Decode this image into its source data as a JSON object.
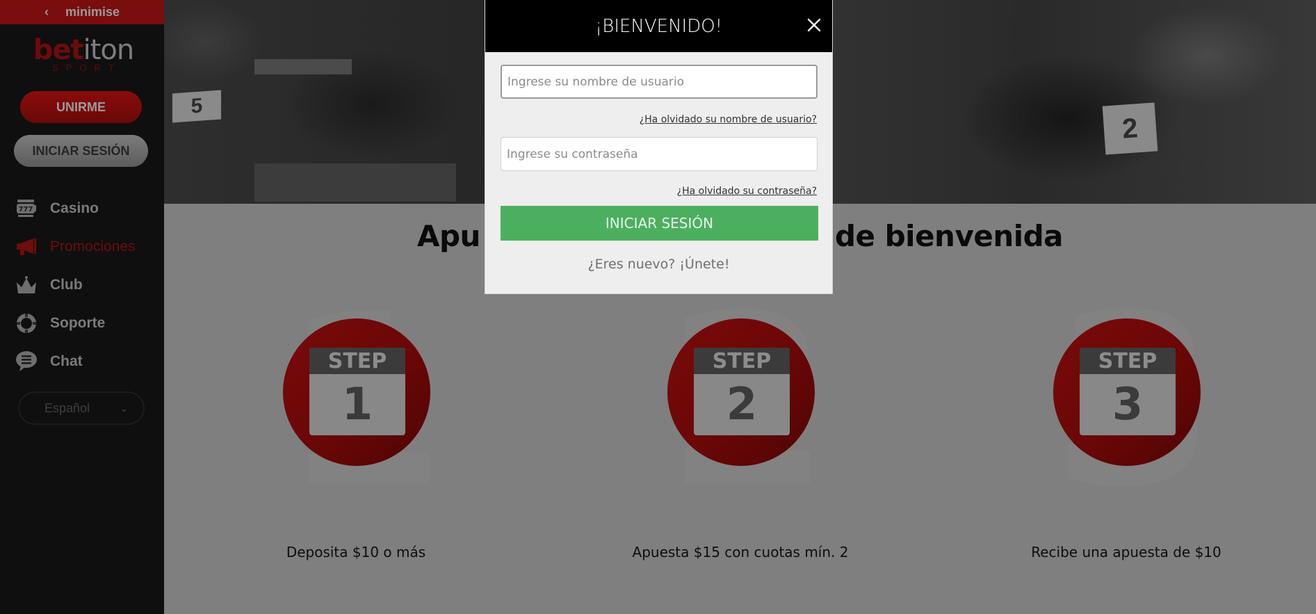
{
  "sidebar": {
    "minimise_label": "minimise",
    "logo": {
      "bet": "bet",
      "iton": "iton",
      "sport": "SPORT"
    },
    "join_button": "UNIRME",
    "login_button": "INICIAR SESIÓN",
    "nav": [
      {
        "label": "Casino",
        "icon": "slot-machine-icon",
        "active": false
      },
      {
        "label": "Promociones",
        "icon": "megaphone-icon",
        "active": true
      },
      {
        "label": "Club",
        "icon": "crown-icon",
        "active": false
      },
      {
        "label": "Soporte",
        "icon": "lifebuoy-icon",
        "active": false
      },
      {
        "label": "Chat",
        "icon": "chat-bubble-icon",
        "active": false
      }
    ],
    "language": {
      "selected": "Español"
    }
  },
  "hero": {
    "bibs": [
      "5",
      "2"
    ]
  },
  "main": {
    "headline_left": "Apu",
    "headline_right": "de bienvenida",
    "steps": [
      {
        "badge": "STEP",
        "number": "1",
        "caption": "Deposita $10 o más"
      },
      {
        "badge": "STEP",
        "number": "2",
        "caption": "Apuesta $15 con cuotas mín. 2"
      },
      {
        "badge": "STEP",
        "number": "3",
        "caption": "Recibe una apuesta de $10"
      }
    ]
  },
  "modal": {
    "title": "¡BIENVENIDO!",
    "username": {
      "value": "",
      "placeholder": "Ingrese su nombre de usuario"
    },
    "forgot_username": "¿Ha olvidado su nombre de usuario?",
    "password": {
      "value": "",
      "placeholder": "Ingrese su contraseña"
    },
    "forgot_password": "¿Ha olvidado su contraseña?",
    "submit": "INICIAR SESIÓN",
    "join_prompt": "¿Eres nuevo? ¡Únete!"
  },
  "colors": {
    "brand_red": "#7a0d0d",
    "submit_green": "#4caf60",
    "overlay_gray": "#7f7f7f"
  }
}
